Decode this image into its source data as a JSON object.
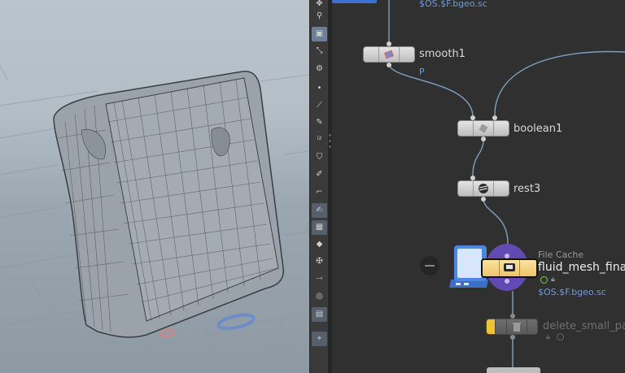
{
  "nodes": {
    "top_expr": "$OS.$F.bgeo.sc",
    "smooth": {
      "name": "smooth1",
      "sub": "P"
    },
    "boolean": {
      "name": "boolean1"
    },
    "rest": {
      "name": "rest3"
    },
    "filecache": {
      "type_label": "File Cache",
      "name": "fluid_mesh_final",
      "expr": "$OS.$F.bgeo.sc"
    },
    "delete": {
      "name": "delete_small_pa"
    }
  },
  "colors": {
    "wire": "#7f9fc2",
    "node_body": "#d5d5d5",
    "expr_text": "#6d9bd6",
    "delete_flag": "#f1c232",
    "filecache_ring": "#6a4fc8",
    "filecache_body": "#f7d98a"
  },
  "icons": [
    "select-icon",
    "view-icon",
    "scale-icon",
    "transform-icon",
    "pose-icon",
    "point-icon",
    "knife-icon",
    "pen-icon",
    "number-icon",
    "stamp-icon",
    "paint-icon",
    "corner-icon",
    "sculpt-icon",
    "uv-icon",
    "diamond-icon",
    "bones-icon",
    "tangent-icon",
    "circle-icon",
    "snapshot-icon",
    "pin-icon"
  ]
}
